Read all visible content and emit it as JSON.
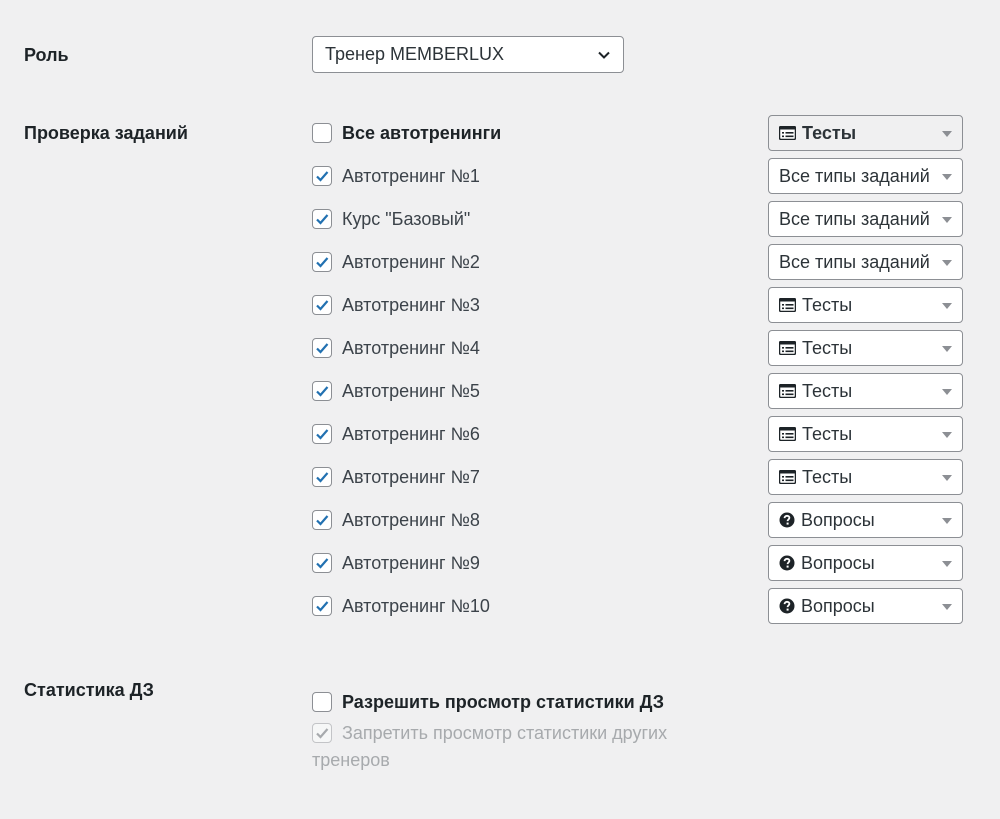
{
  "role": {
    "label": "Роль",
    "selected": "Тренер MEMBERLUX"
  },
  "tasks": {
    "label": "Проверка заданий",
    "all": {
      "label": "Все автотренинги",
      "checked": false,
      "filter": "Тесты",
      "filter_icon": "list-icon"
    },
    "items": [
      {
        "label": "Автотренинг №1",
        "checked": true,
        "filter": "Все типы заданий",
        "filter_icon": ""
      },
      {
        "label": "Курс \"Базовый\"",
        "checked": true,
        "filter": "Все типы заданий",
        "filter_icon": ""
      },
      {
        "label": "Автотренинг №2",
        "checked": true,
        "filter": "Все типы заданий",
        "filter_icon": ""
      },
      {
        "label": "Автотренинг №3",
        "checked": true,
        "filter": "Тесты",
        "filter_icon": "list-icon"
      },
      {
        "label": "Автотренинг №4",
        "checked": true,
        "filter": "Тесты",
        "filter_icon": "list-icon"
      },
      {
        "label": "Автотренинг №5",
        "checked": true,
        "filter": "Тесты",
        "filter_icon": "list-icon"
      },
      {
        "label": "Автотренинг №6",
        "checked": true,
        "filter": "Тесты",
        "filter_icon": "list-icon"
      },
      {
        "label": "Автотренинг №7",
        "checked": true,
        "filter": "Тесты",
        "filter_icon": "list-icon"
      },
      {
        "label": "Автотренинг №8",
        "checked": true,
        "filter": "Вопросы",
        "filter_icon": "question-icon"
      },
      {
        "label": "Автотренинг №9",
        "checked": true,
        "filter": "Вопросы",
        "filter_icon": "question-icon"
      },
      {
        "label": "Автотренинг №10",
        "checked": true,
        "filter": "Вопросы",
        "filter_icon": "question-icon"
      }
    ]
  },
  "stats": {
    "label": "Статистика ДЗ",
    "allow": {
      "label": "Разрешить просмотр статистики ДЗ",
      "checked": false
    },
    "deny": {
      "label_line1": "Запретить просмотр статистики других",
      "label_line2": "тренеров",
      "checked": true,
      "disabled": true
    }
  },
  "colors": {
    "check": "#2271b1",
    "check_disabled": "#a7aaad"
  }
}
